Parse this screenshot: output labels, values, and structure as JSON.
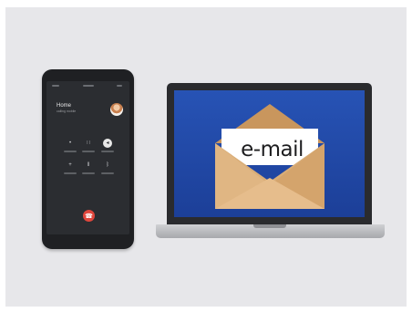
{
  "phone": {
    "caller_name": "Home",
    "caller_status": "calling mobile",
    "buttons": [
      {
        "icon": "microphone-icon",
        "glyph": "•"
      },
      {
        "icon": "keypad-icon",
        "glyph": "∷"
      },
      {
        "icon": "speaker-icon",
        "glyph": "◂"
      },
      {
        "icon": "add-call-icon",
        "glyph": "+"
      },
      {
        "icon": "hold-icon",
        "glyph": "‖"
      },
      {
        "icon": "bluetooth-icon",
        "glyph": "ᛒ"
      }
    ],
    "end_call_glyph": "☎"
  },
  "laptop": {
    "email_label": "e-mail"
  },
  "colors": {
    "background": "#e7e7ea",
    "screen_blue": "#2753b5",
    "envelope": "#d7ab74",
    "end_call": "#e0463c"
  }
}
